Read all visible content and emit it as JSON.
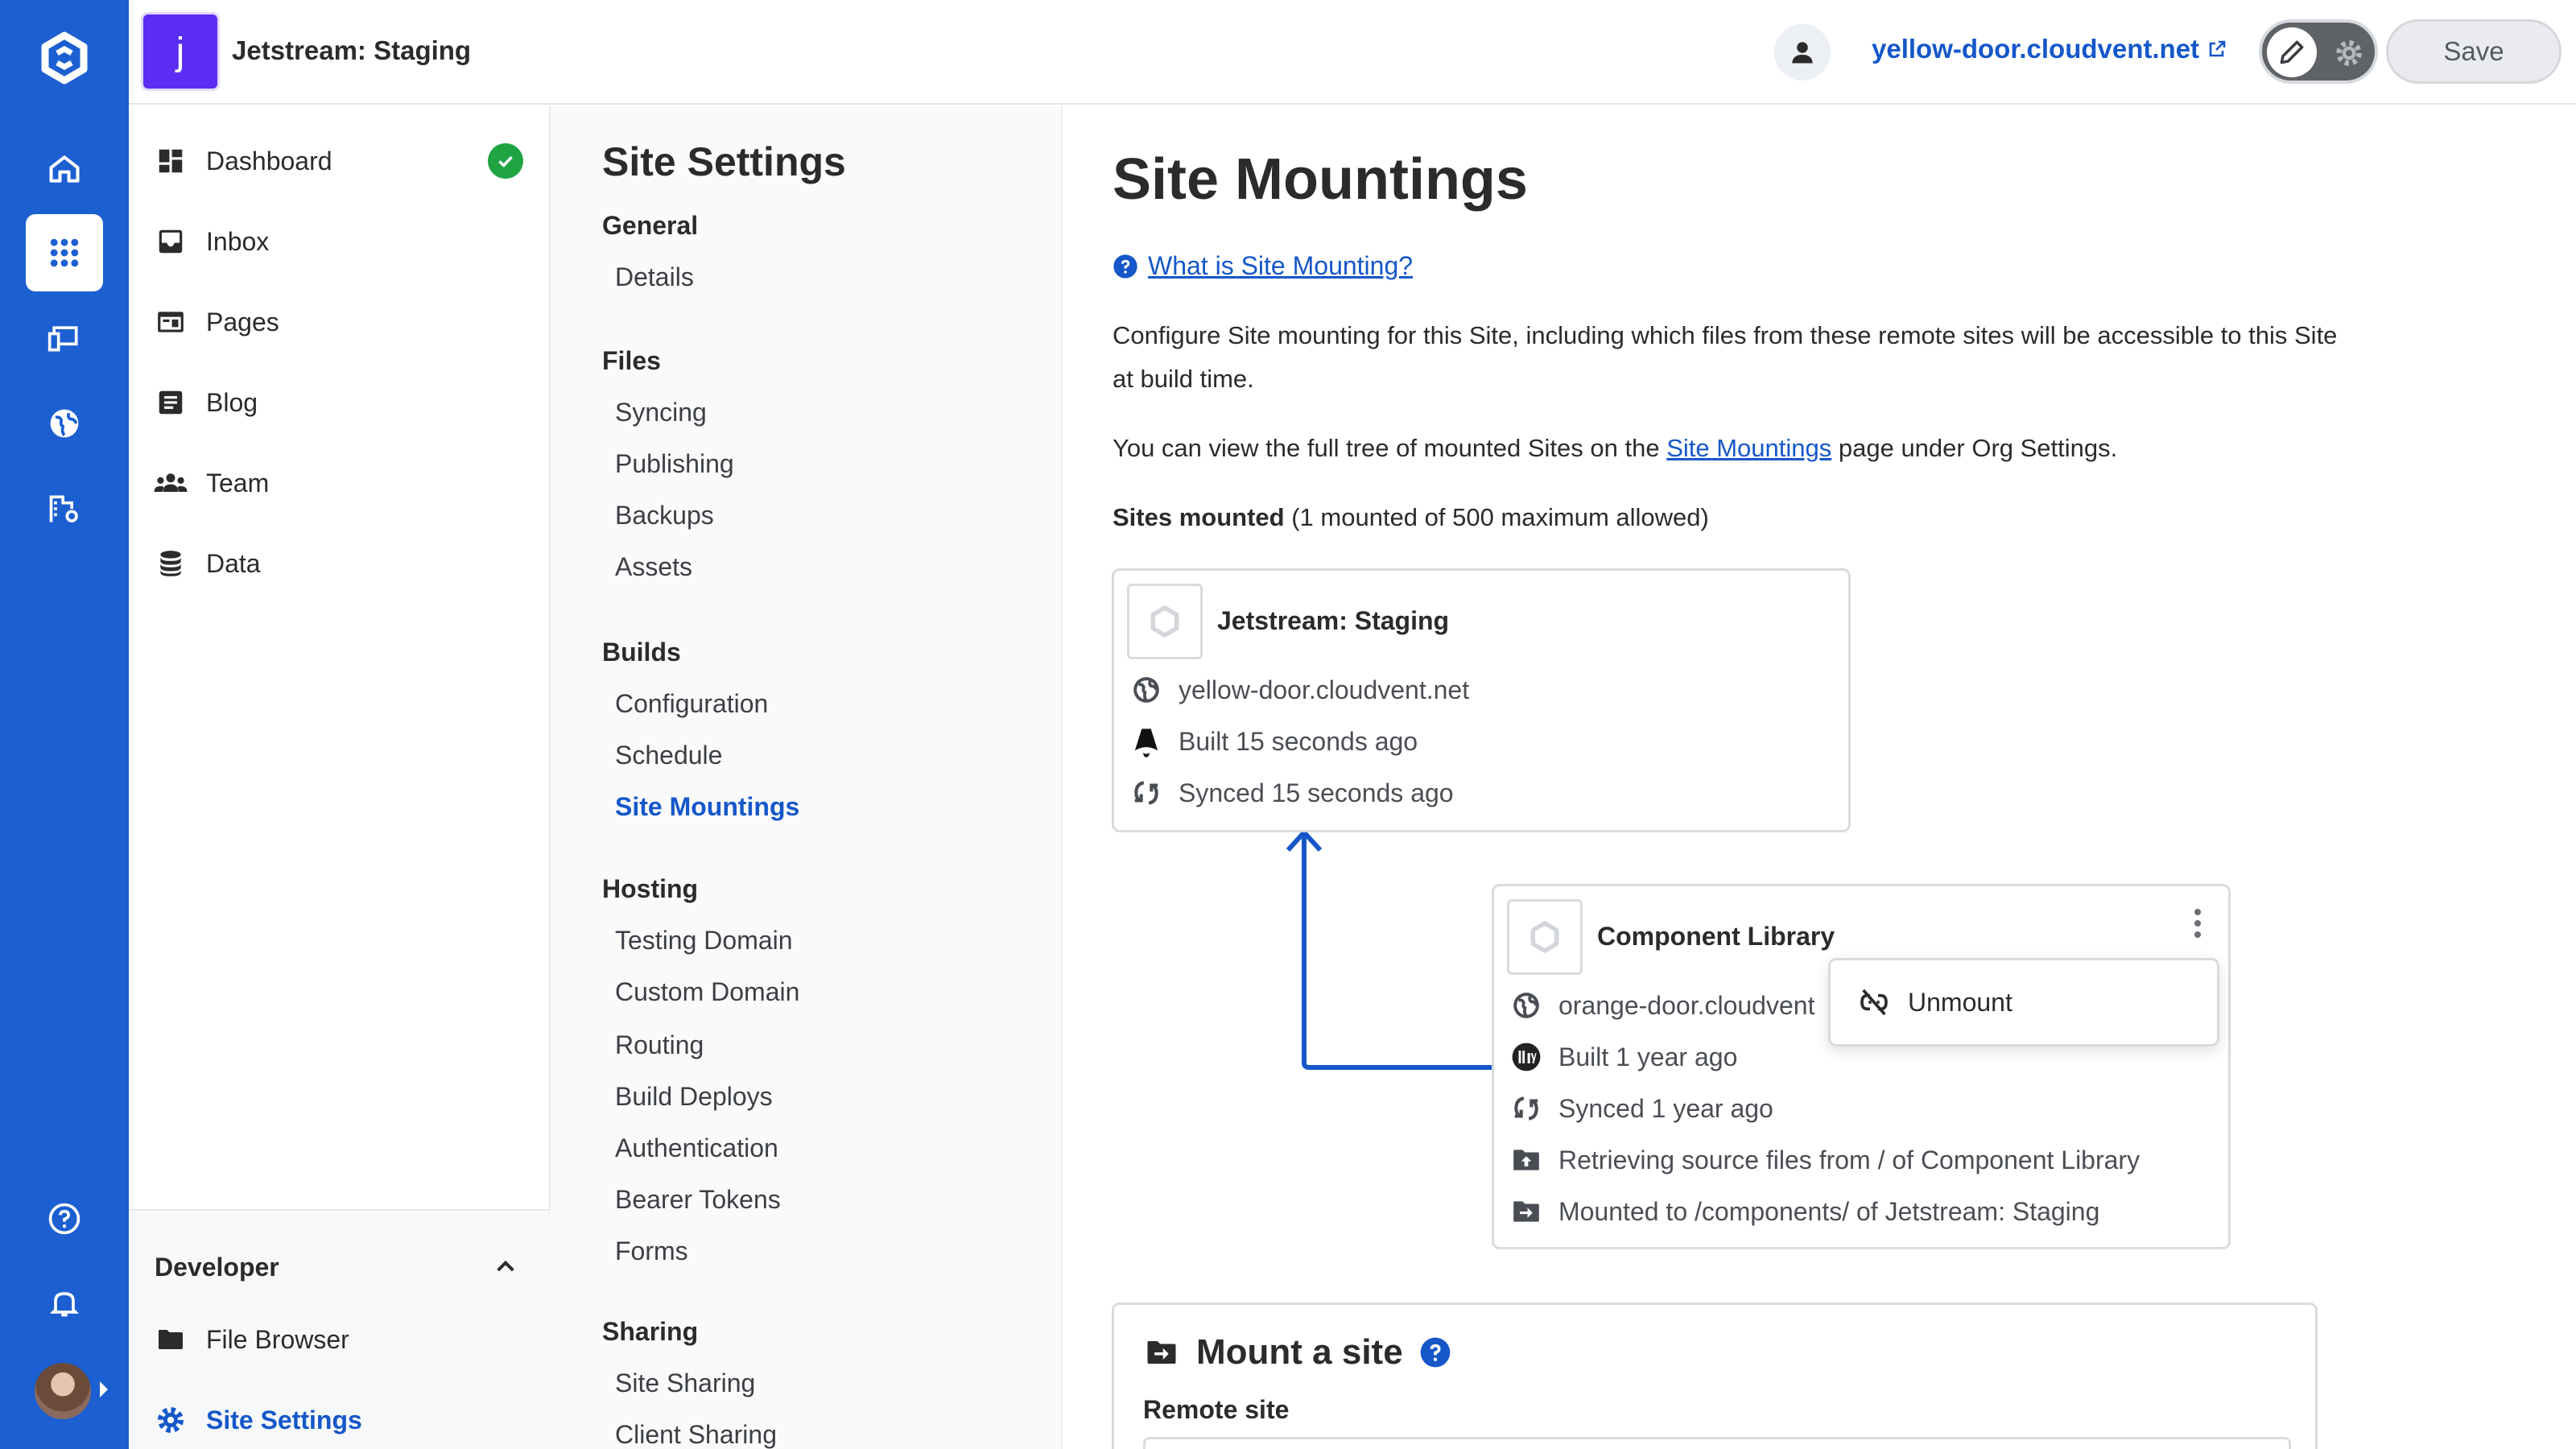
{
  "header": {
    "site_initial": "j",
    "site_name": "Jetstream: Staging",
    "domain": "yellow-door.cloudvent.net",
    "save_label": "Save"
  },
  "sidebar": {
    "items": [
      {
        "label": "Dashboard",
        "icon": "dashboard-icon"
      },
      {
        "label": "Inbox",
        "icon": "inbox-icon"
      },
      {
        "label": "Pages",
        "icon": "pages-icon"
      },
      {
        "label": "Blog",
        "icon": "blog-icon"
      },
      {
        "label": "Team",
        "icon": "team-icon"
      },
      {
        "label": "Data",
        "icon": "data-icon"
      }
    ],
    "developer": {
      "title": "Developer",
      "items": [
        {
          "label": "File Browser",
          "icon": "folder-icon"
        },
        {
          "label": "Site Settings",
          "icon": "gear-icon"
        }
      ]
    }
  },
  "settings_nav": {
    "title": "Site Settings",
    "groups": [
      {
        "label": "General",
        "items": [
          "Details"
        ]
      },
      {
        "label": "Files",
        "items": [
          "Syncing",
          "Publishing",
          "Backups",
          "Assets"
        ]
      },
      {
        "label": "Builds",
        "items": [
          "Configuration",
          "Schedule",
          "Site Mountings"
        ]
      },
      {
        "label": "Hosting",
        "items": [
          "Testing Domain",
          "Custom Domain",
          "Routing",
          "Build Deploys",
          "Authentication",
          "Bearer Tokens",
          "Forms"
        ]
      },
      {
        "label": "Sharing",
        "items": [
          "Site Sharing",
          "Client Sharing"
        ]
      }
    ],
    "active": "Site Mountings"
  },
  "main": {
    "title": "Site Mountings",
    "help_link": "What is Site Mounting?",
    "description": "Configure Site mounting for this Site, including which files from these remote sites will be accessible to this Site at build time.",
    "tree_text_before": "You can view the full tree of mounted Sites on the ",
    "tree_link": "Site Mountings",
    "tree_text_after": " page under Org Settings.",
    "sites_mounted_label": "Sites mounted",
    "sites_mounted_count": "(1 mounted of 500 maximum allowed)",
    "parent_card": {
      "title": "Jetstream: Staging",
      "domain": "yellow-door.cloudvent.net",
      "built": "Built 15 seconds ago",
      "synced": "Synced 15 seconds ago"
    },
    "child_card": {
      "title": "Component Library",
      "domain": "orange-door.cloudvent",
      "built": "Built 1 year ago",
      "synced": "Synced 1 year ago",
      "source": "Retrieving source files from / of Component Library",
      "mounted": "Mounted to /components/ of Jetstream: Staging"
    },
    "menu": {
      "unmount_label": "Unmount"
    },
    "mount_box": {
      "title": "Mount a site",
      "remote_label": "Remote site"
    }
  }
}
